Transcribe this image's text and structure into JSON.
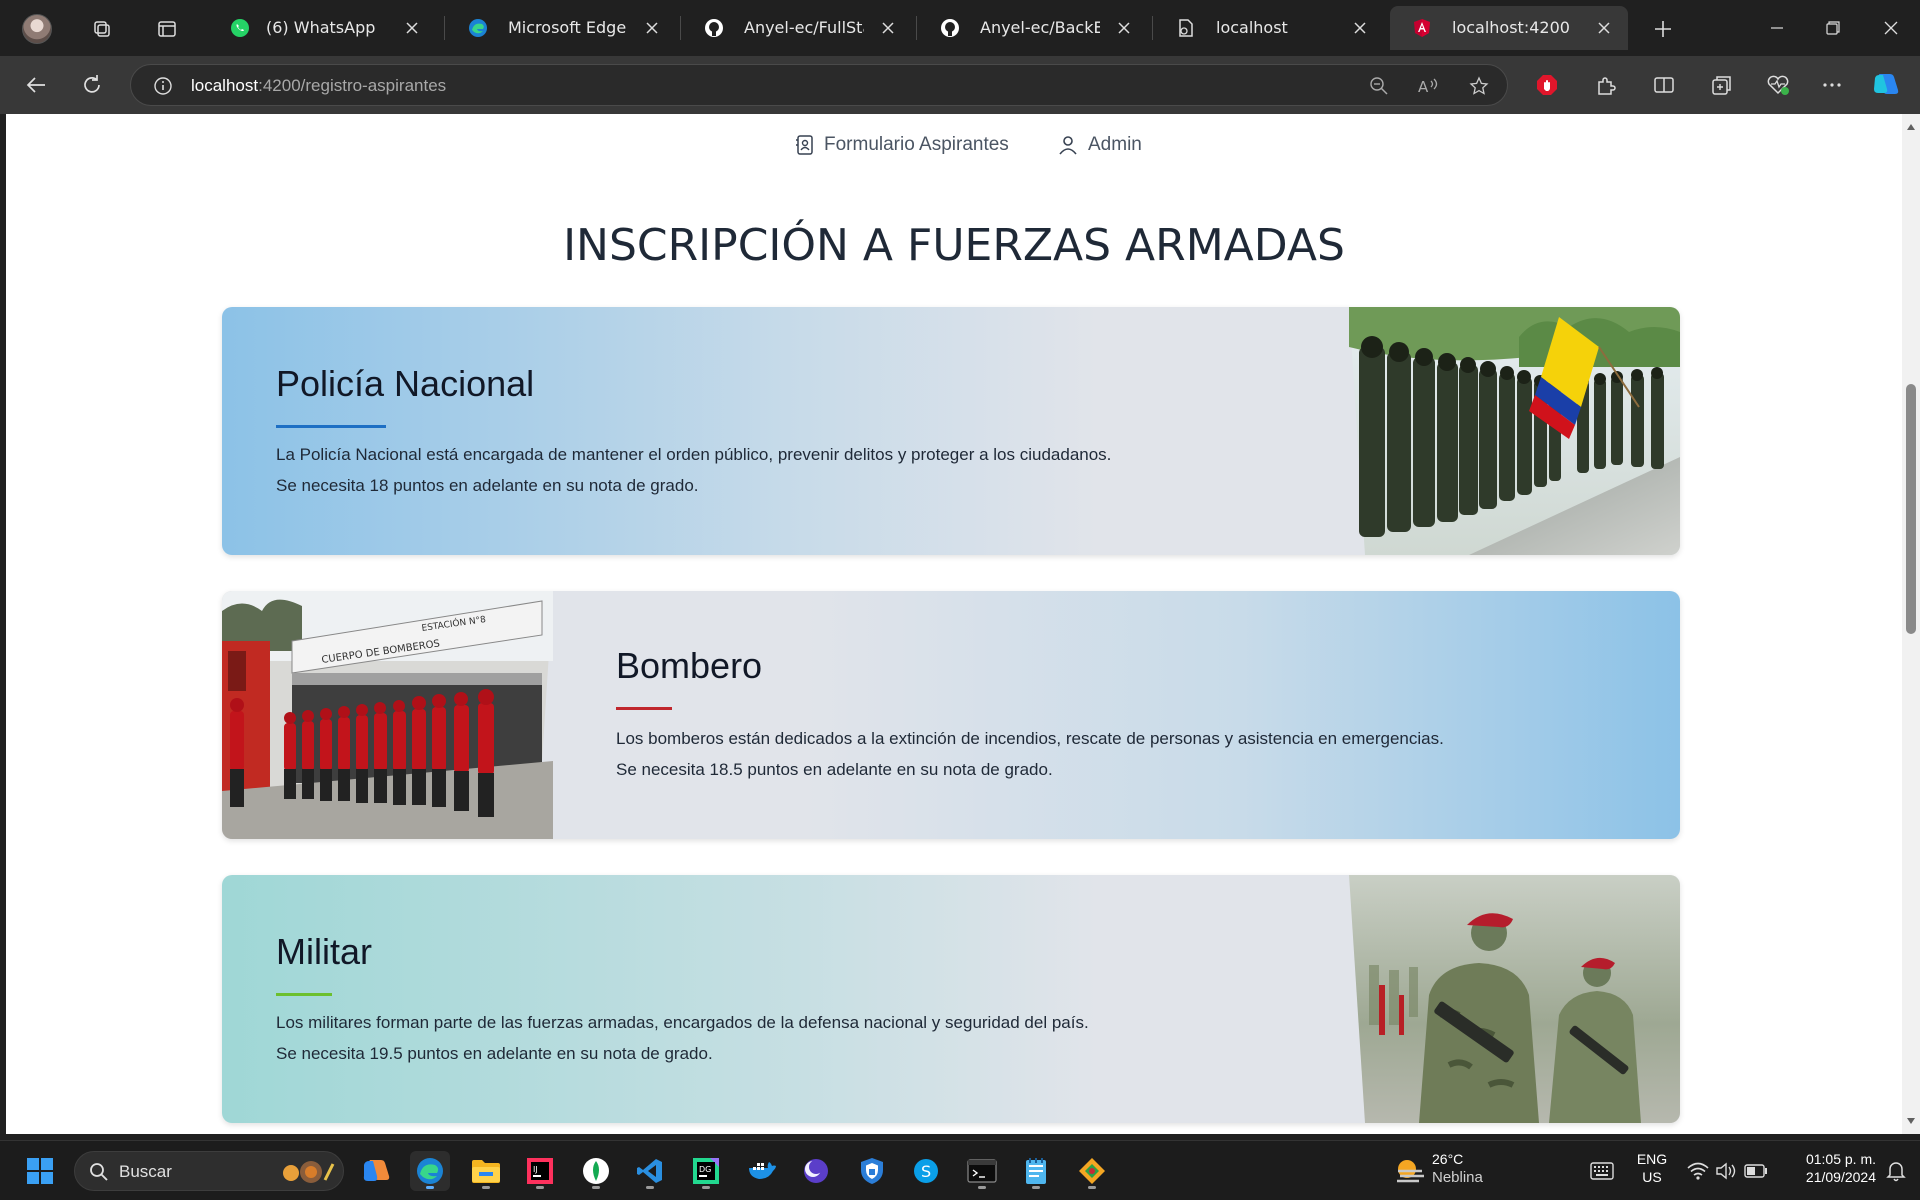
{
  "browser": {
    "tabs": [
      {
        "label": "(6) WhatsApp",
        "icon": "whatsapp-icon"
      },
      {
        "label": "Microsoft Edge | N",
        "icon": "edge-icon"
      },
      {
        "label": "Anyel-ec/FullStack",
        "icon": "github-icon"
      },
      {
        "label": "Anyel-ec/BackEnd",
        "icon": "github-icon"
      },
      {
        "label": "localhost",
        "icon": "page-icon"
      },
      {
        "label": "localhost:4200",
        "icon": "angular-icon"
      }
    ],
    "active_tab_index": 5,
    "url_host": "localhost",
    "url_path": ":4200/registro-aspirantes"
  },
  "nav": {
    "items": [
      {
        "label": "Formulario Aspirantes",
        "icon": "contact-form-icon"
      },
      {
        "label": "Admin",
        "icon": "user-icon"
      }
    ]
  },
  "page": {
    "title": "INSCRIPCIÓN A FUERZAS ARMADAS",
    "cards": [
      {
        "title": "Policía Nacional",
        "description": "La Policía Nacional está encargada de mantener el orden público, prevenir delitos y proteger a los ciudadanos.",
        "requirement": "Se necesita 18 puntos en adelante en su nota de grado.",
        "accent": "#1d6fc4"
      },
      {
        "title": "Bombero",
        "description": "Los bomberos están dedicados a la extinción de incendios, rescate de personas y asistencia en emergencias.",
        "requirement": "Se necesita 18.5 puntos en adelante en su nota de grado.",
        "accent": "#c0262d"
      },
      {
        "title": "Militar",
        "description": "Los militares forman parte de las fuerzas armadas, encargados de la defensa nacional y seguridad del país.",
        "requirement": "Se necesita 19.5 puntos en adelante en su nota de grado.",
        "accent": "#6cc02e"
      }
    ]
  },
  "taskbar": {
    "search_label": "Buscar",
    "weather_temp": "26°C",
    "weather_desc": "Neblina",
    "lang_line1": "ENG",
    "lang_line2": "US",
    "time": "01:05 p. m.",
    "date": "21/09/2024"
  }
}
